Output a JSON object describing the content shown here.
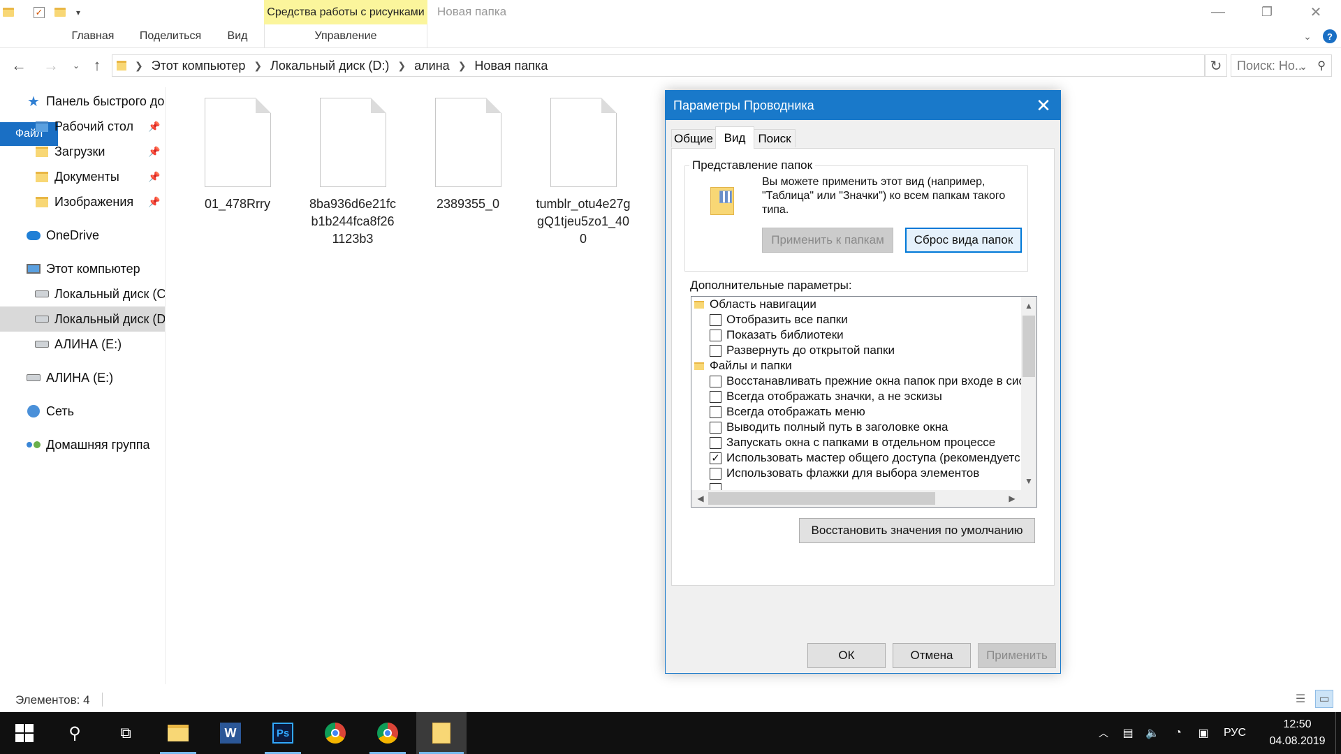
{
  "window": {
    "context_tab_label": "Средства работы с рисунками",
    "title": "Новая папка",
    "minimize_glyph": "—",
    "maximize_glyph": "❐",
    "close_glyph": "✕"
  },
  "ribbon": {
    "tabs": [
      "Файл",
      "Главная",
      "Поделиться",
      "Вид"
    ],
    "context_subtab": "Управление"
  },
  "address": {
    "segments": [
      "Этот компьютер",
      "Локальный диск (D:)",
      "алина",
      "Новая папка"
    ],
    "search_placeholder": "Поиск: Но..."
  },
  "nav": {
    "items": [
      {
        "label": "Панель быстрого до",
        "icon": "star-icon",
        "pinned": false
      },
      {
        "label": "Рабочий стол",
        "icon": "folder-icon",
        "pinned": true
      },
      {
        "label": "Загрузки",
        "icon": "downloads-folder-icon",
        "pinned": true
      },
      {
        "label": "Документы",
        "icon": "documents-folder-icon",
        "pinned": true
      },
      {
        "label": "Изображения",
        "icon": "pictures-folder-icon",
        "pinned": true
      },
      {
        "label": "OneDrive",
        "icon": "cloud-icon",
        "pinned": false
      },
      {
        "label": "Этот компьютер",
        "icon": "computer-icon",
        "pinned": false
      },
      {
        "label": "Локальный диск (C:",
        "icon": "drive-icon",
        "pinned": false
      },
      {
        "label": "Локальный диск (D",
        "icon": "drive-icon",
        "pinned": false
      },
      {
        "label": "АЛИНА (E:)",
        "icon": "usb-drive-icon",
        "pinned": false
      },
      {
        "label": "АЛИНА (E:)",
        "icon": "usb-drive-icon",
        "pinned": false
      },
      {
        "label": "Сеть",
        "icon": "network-icon",
        "pinned": false
      },
      {
        "label": "Домашняя группа",
        "icon": "homegroup-icon",
        "pinned": false
      }
    ]
  },
  "files": [
    {
      "name": "01_478Rrry"
    },
    {
      "name": "8ba936d6e21fcb1b244fca8f261123b3"
    },
    {
      "name": "2389355_0"
    },
    {
      "name": "tumblr_otu4e27ggQ1tjeu5zo1_400"
    }
  ],
  "status": {
    "items_count": "Элементов: 4"
  },
  "dialog": {
    "title": "Параметры Проводника",
    "tabs": [
      "Общие",
      "Вид",
      "Поиск"
    ],
    "folder_views_title": "Представление папок",
    "folder_views_text": "Вы можете применить этот вид (например, \"Таблица\" или \"Значки\") ко всем папкам такого типа.",
    "apply_to_folders": "Применить к папкам",
    "reset_folders": "Сброс вида папок",
    "advanced_label": "Дополнительные параметры:",
    "tree": [
      {
        "kind": "folder",
        "label": "Область навигации"
      },
      {
        "kind": "check",
        "label": "Отобразить все папки",
        "checked": false
      },
      {
        "kind": "check",
        "label": "Показать библиотеки",
        "checked": false
      },
      {
        "kind": "check",
        "label": "Развернуть до открытой папки",
        "checked": false
      },
      {
        "kind": "folder",
        "label": "Файлы и папки"
      },
      {
        "kind": "check",
        "label": "Восстанавливать прежние окна папок при входе в сис",
        "checked": false
      },
      {
        "kind": "check",
        "label": "Всегда отображать значки, а не эскизы",
        "checked": false
      },
      {
        "kind": "check",
        "label": "Всегда отображать меню",
        "checked": false
      },
      {
        "kind": "check",
        "label": "Выводить полный путь в заголовке окна",
        "checked": false
      },
      {
        "kind": "check",
        "label": "Запускать окна с папками в отдельном процессе",
        "checked": false
      },
      {
        "kind": "check",
        "label": "Использовать мастер общего доступа (рекомендуетс:",
        "checked": true
      },
      {
        "kind": "check",
        "label": "Использовать флажки для выбора элементов",
        "checked": false
      }
    ],
    "restore_defaults": "Восстановить значения по умолчанию",
    "ok": "ОК",
    "cancel": "Отмена",
    "apply": "Применить"
  },
  "taskbar": {
    "apps": [
      "file-explorer",
      "word",
      "photoshop",
      "chrome",
      "chrome",
      "sticky-folder"
    ],
    "language": "РУС",
    "time": "12:50",
    "date": "04.08.2019",
    "photoshop_label": "Ps",
    "word_label": "W"
  }
}
